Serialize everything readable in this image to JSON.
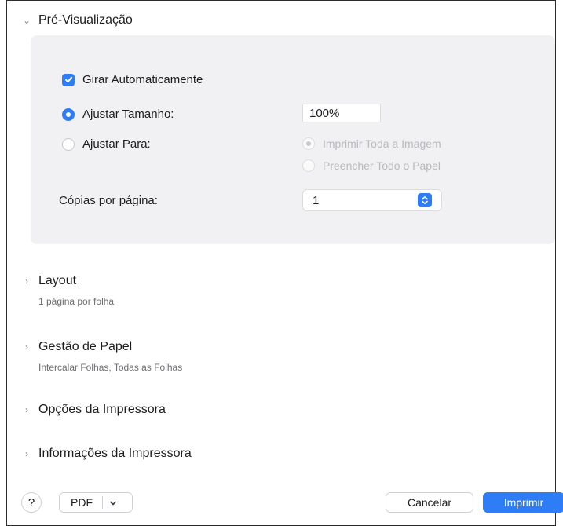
{
  "preview": {
    "title": "Pré-Visualização",
    "auto_rotate_label": "Girar Automaticamente",
    "fit_size_label": "Ajustar Tamanho:",
    "fit_size_value": "100%",
    "fit_to_label": "Ajustar Para:",
    "print_entire_label": "Imprimir Toda a Imagem",
    "fill_paper_label": "Preencher Todo o Papel",
    "copies_per_page_label": "Cópias por página:",
    "copies_per_page_value": "1"
  },
  "sections": [
    {
      "title": "Layout",
      "subtitle": "1 página por folha"
    },
    {
      "title": "Gestão de Papel",
      "subtitle": "Intercalar Folhas, Todas as Folhas"
    },
    {
      "title": "Opções da Impressora",
      "subtitle": ""
    },
    {
      "title": "Informações da Impressora",
      "subtitle": ""
    }
  ],
  "footer": {
    "help_label": "?",
    "pdf_label": "PDF",
    "cancel_label": "Cancelar",
    "print_label": "Imprimir"
  },
  "colors": {
    "accent": "#2f7df6",
    "panel_bg": "#f1f1f3",
    "disabled_text": "#b9b9bd"
  }
}
